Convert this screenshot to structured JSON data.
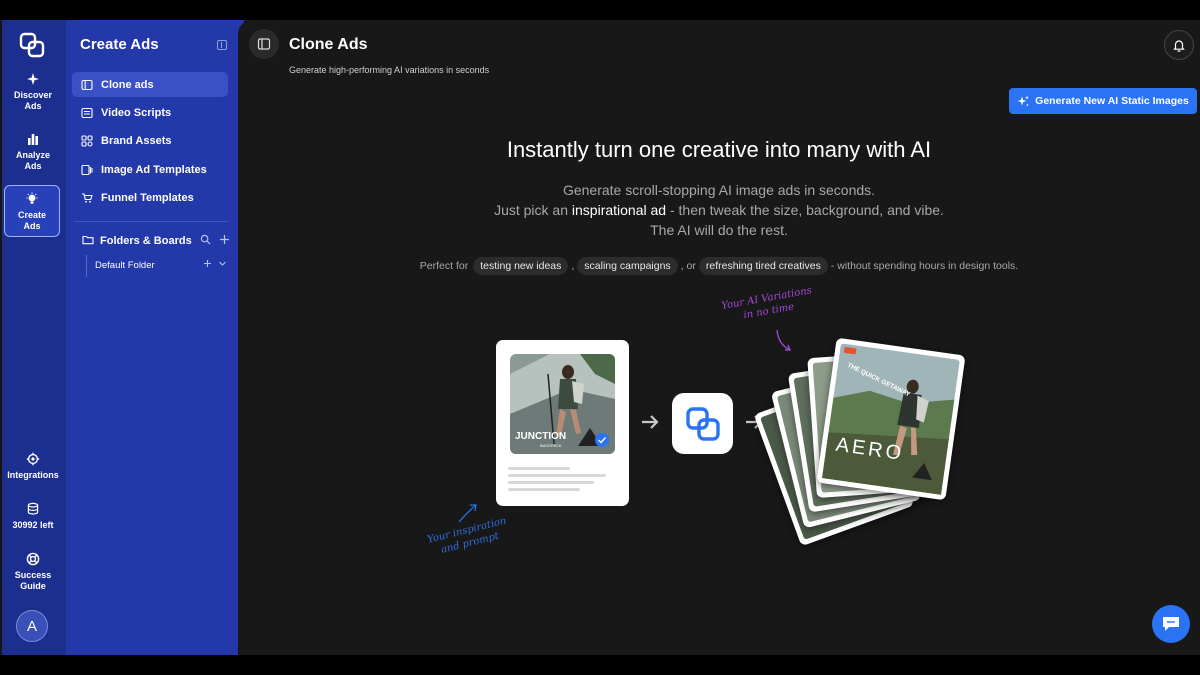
{
  "rail": {
    "items": [
      {
        "label": "Discover Ads",
        "icon": "sparkle-star-icon"
      },
      {
        "label": "Analyze Ads",
        "icon": "bar-chart-icon"
      },
      {
        "label": "Create Ads",
        "icon": "lightbulb-icon"
      },
      {
        "label": "Integrations",
        "icon": "gear-icon"
      },
      {
        "label": "30992 left",
        "icon": "coins-icon"
      },
      {
        "label": "Success Guide",
        "icon": "lifebuoy-icon"
      }
    ],
    "active": "Create Ads",
    "avatar": "A"
  },
  "sidebar": {
    "title": "Create Ads",
    "items": [
      {
        "label": "Clone ads",
        "icon": "clone-panel-icon"
      },
      {
        "label": "Video Scripts",
        "icon": "script-icon"
      },
      {
        "label": "Brand Assets",
        "icon": "assets-grid-icon"
      },
      {
        "label": "Image Ad Templates",
        "icon": "image-template-icon"
      },
      {
        "label": "Funnel Templates",
        "icon": "funnel-cart-icon"
      }
    ],
    "active": "Clone ads",
    "folders_label": "Folders & Boards",
    "default_folder": "Default Folder"
  },
  "main": {
    "title": "Clone Ads",
    "subtitle": "Generate high-performing AI variations in seconds",
    "cta": "Generate New AI Static Images",
    "hero_title": "Instantly turn one creative into many with AI",
    "hero_line1": "Generate scroll-stopping AI image ads in seconds.",
    "hero_line2_pre": "Just pick an ",
    "hero_line2_hl": "inspirational ad",
    "hero_line2_post": " - then tweak the size, background, and vibe.",
    "hero_line3": "The AI will do the rest.",
    "perfect_prefix": "Perfect for",
    "chips": [
      "testing new ideas",
      "scaling campaigns",
      "refreshing tired creatives"
    ],
    "sep1": ",",
    "sep2": ", or",
    "perfect_suffix": "- without spending hours in design tools."
  },
  "illustration": {
    "source_caption": "JUNCTION",
    "source_sub": "BACKPACK",
    "variation_caption": "AERO",
    "variation_tag": "THE QUICK GETAWAY",
    "note_variations": "Your AI Variations\nin no time",
    "note_inspiration": "Your inspiration\nand prompt"
  },
  "colors": {
    "rail": "#1d2f8e",
    "sidebar": "#2338a9",
    "main_bg": "#181818",
    "accent": "#2a73f5",
    "note_purple": "#a24ad8",
    "note_blue": "#2f6fe0"
  }
}
